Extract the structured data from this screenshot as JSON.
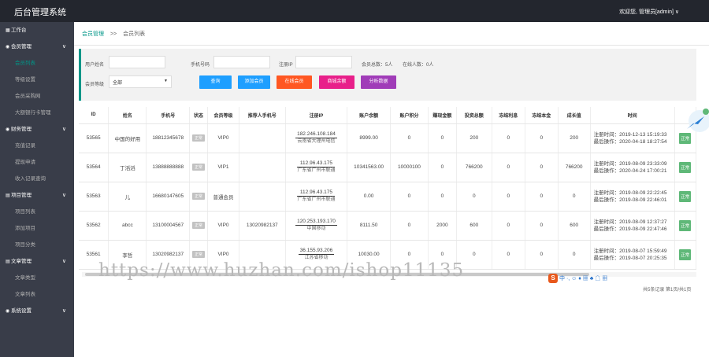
{
  "topbar": {
    "title": "后台管理系统",
    "user": "欢迎您, 管理员[admin]",
    "caret": "∨"
  },
  "sidebar": [
    {
      "label": "工作台",
      "level": "top",
      "icon": "▦"
    },
    {
      "label": "会员管理",
      "level": "top",
      "icon": "◉",
      "chev": "∨"
    },
    {
      "label": "会员列表",
      "level": "sub",
      "active": true
    },
    {
      "label": "等级设置",
      "level": "sub"
    },
    {
      "label": "会员采购网",
      "level": "sub"
    },
    {
      "label": "大额银行卡管理",
      "level": "sub"
    },
    {
      "label": "财务管理",
      "level": "top",
      "icon": "◉",
      "chev": "∨"
    },
    {
      "label": "充值记录",
      "level": "sub"
    },
    {
      "label": "提现申请",
      "level": "sub"
    },
    {
      "label": "收入记录查询",
      "level": "sub"
    },
    {
      "label": "项目管理",
      "level": "top",
      "icon": "▤",
      "chev": "∨"
    },
    {
      "label": "项目列表",
      "level": "sub"
    },
    {
      "label": "添加项目",
      "level": "sub"
    },
    {
      "label": "项目分类",
      "level": "sub"
    },
    {
      "label": "文章管理",
      "level": "top",
      "icon": "▤",
      "chev": "∨"
    },
    {
      "label": "文章类型",
      "level": "sub"
    },
    {
      "label": "文章列表",
      "level": "sub"
    },
    {
      "label": "系统设置",
      "level": "top",
      "icon": "◉",
      "chev": "∨"
    }
  ],
  "breadcrumb": {
    "parent": "会员管理",
    "sep": ">>",
    "current": "会员列表"
  },
  "filters": {
    "username_label": "用户姓名",
    "phone_label": "手机号码",
    "ip_label": "注册IP",
    "total_label": "会员总数：5人",
    "online_label": "在线人数：0人",
    "level_label": "会员等级",
    "level_value": "全部"
  },
  "buttons": [
    {
      "label": "查询",
      "color": "#1e9fff"
    },
    {
      "label": "添加会员",
      "color": "#1e9fff"
    },
    {
      "label": "在线会员",
      "color": "#ff5722"
    },
    {
      "label": "商城余额",
      "color": "#e8208a"
    },
    {
      "label": "分析数据",
      "color": "#a03cb8"
    }
  ],
  "table": {
    "headers": [
      "ID",
      "姓名",
      "手机号",
      "状态",
      "会员等级",
      "推荐人手机号",
      "注册IP",
      "账户余额",
      "账户积分",
      "赚现金额",
      "投资总额",
      "冻结利息",
      "冻结本金",
      "成长值",
      "时间",
      ""
    ],
    "rows": [
      {
        "id": "53565",
        "name": "中国的好用",
        "phone": "18812345678",
        "status": "正常",
        "level": "VIP0",
        "ref": "",
        "ip": "182.246.108.184",
        "loc": "云南省大理州电信",
        "balance": "8999.00",
        "points": "0",
        "cash": "0",
        "invest": "200",
        "fi": "0",
        "fp": "0",
        "growth": "200",
        "t1": "注册时间：2019-12-13 15:19:33",
        "t2": "最后操作：2020-04-18 18:27:54",
        "op": "正常"
      },
      {
        "id": "53564",
        "name": "丁滔滔",
        "phone": "13888888888",
        "status": "正常",
        "level": "VIP1",
        "ref": "",
        "ip": "112.96.43.175",
        "loc": "广东省广州市联通",
        "balance": "10341563.00",
        "points": "10000100",
        "cash": "0",
        "invest": "766200",
        "fi": "0",
        "fp": "0",
        "growth": "766200",
        "t1": "注册时间：2019-08-09 23:33:09",
        "t2": "最后操作：2020-04-24 17:00:21",
        "op": "正常"
      },
      {
        "id": "53563",
        "name": "儿",
        "phone": "16680147605",
        "status": "正常",
        "level": "普通会员",
        "ref": "",
        "ip": "112.96.43.175",
        "loc": "广东省广州市联通",
        "balance": "0.00",
        "points": "0",
        "cash": "0",
        "invest": "0",
        "fi": "0",
        "fp": "0",
        "growth": "0",
        "t1": "注册时间：2019-08-09 22:22:45",
        "t2": "最后操作：2019-08-09 22:46:01",
        "op": "正常"
      },
      {
        "id": "53562",
        "name": "abcc",
        "phone": "13100004567",
        "status": "正常",
        "level": "VIP0",
        "ref": "13020982137",
        "ip": "120.253.193.170",
        "loc": "中国移动",
        "balance": "8111.50",
        "points": "0",
        "cash": "2000",
        "invest": "600",
        "fi": "0",
        "fp": "0",
        "growth": "600",
        "t1": "注册时间：2019-08-09 12:37:27",
        "t2": "最后操作：2019-08-09 22:47:46",
        "op": "正常"
      },
      {
        "id": "53561",
        "name": "李哲",
        "phone": "13020982137",
        "status": "正常",
        "level": "VIP0",
        "ref": "",
        "ip": "36.155.93.206",
        "loc": "江苏省移动",
        "balance": "10030.00",
        "points": "0",
        "cash": "0",
        "invest": "0",
        "fi": "0",
        "fp": "0",
        "growth": "0",
        "t1": "注册时间：2019-08-07 15:59:49",
        "t2": "最后操作：2019-08-07 20:25:35",
        "op": "正常"
      }
    ]
  },
  "pager": "共5条记录 第1页/共1页",
  "watermark": "https://www.huzhan.com/ishop11135",
  "ime": {
    "logo": "S",
    "rest": "中 ·, ☺ ♦ ▦ ♣ ☖ ▦"
  }
}
